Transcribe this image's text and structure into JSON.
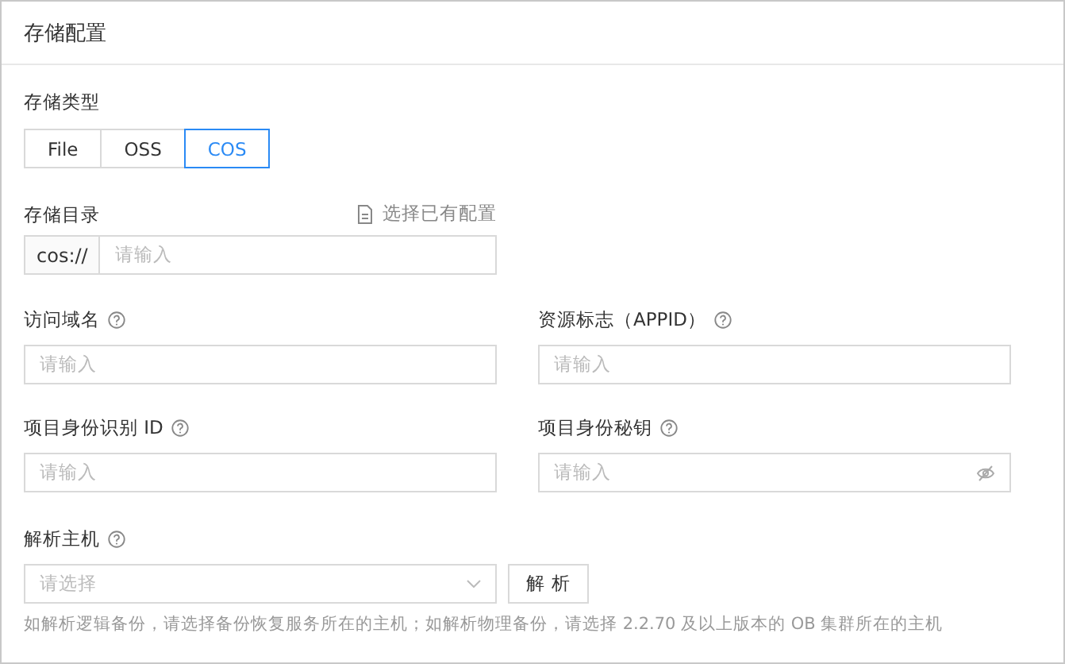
{
  "page": {
    "title": "存储配置"
  },
  "storage_type": {
    "label": "存储类型",
    "options": [
      {
        "label": "File",
        "selected": false
      },
      {
        "label": "OSS",
        "selected": false
      },
      {
        "label": "COS",
        "selected": true
      }
    ]
  },
  "storage_dir": {
    "label": "存储目录",
    "link": "选择已有配置",
    "prefix": "cos://",
    "placeholder": "请输入"
  },
  "fields": [
    {
      "label": "访问域名",
      "placeholder": "请输入",
      "kind": "text"
    },
    {
      "label": "资源标志（APPID）",
      "placeholder": "请输入",
      "kind": "text"
    },
    {
      "label": "项目身份识别 ID",
      "placeholder": "请输入",
      "kind": "text"
    },
    {
      "label": "项目身份秘钥",
      "placeholder": "请输入",
      "kind": "password"
    }
  ],
  "host": {
    "label": "解析主机",
    "placeholder": "请选择",
    "button": "解 析",
    "hint": "如解析逻辑备份，请选择备份恢复服务所在的主机；如解析物理备份，请选择 2.2.70 及以上版本的 OB 集群所在的主机"
  }
}
